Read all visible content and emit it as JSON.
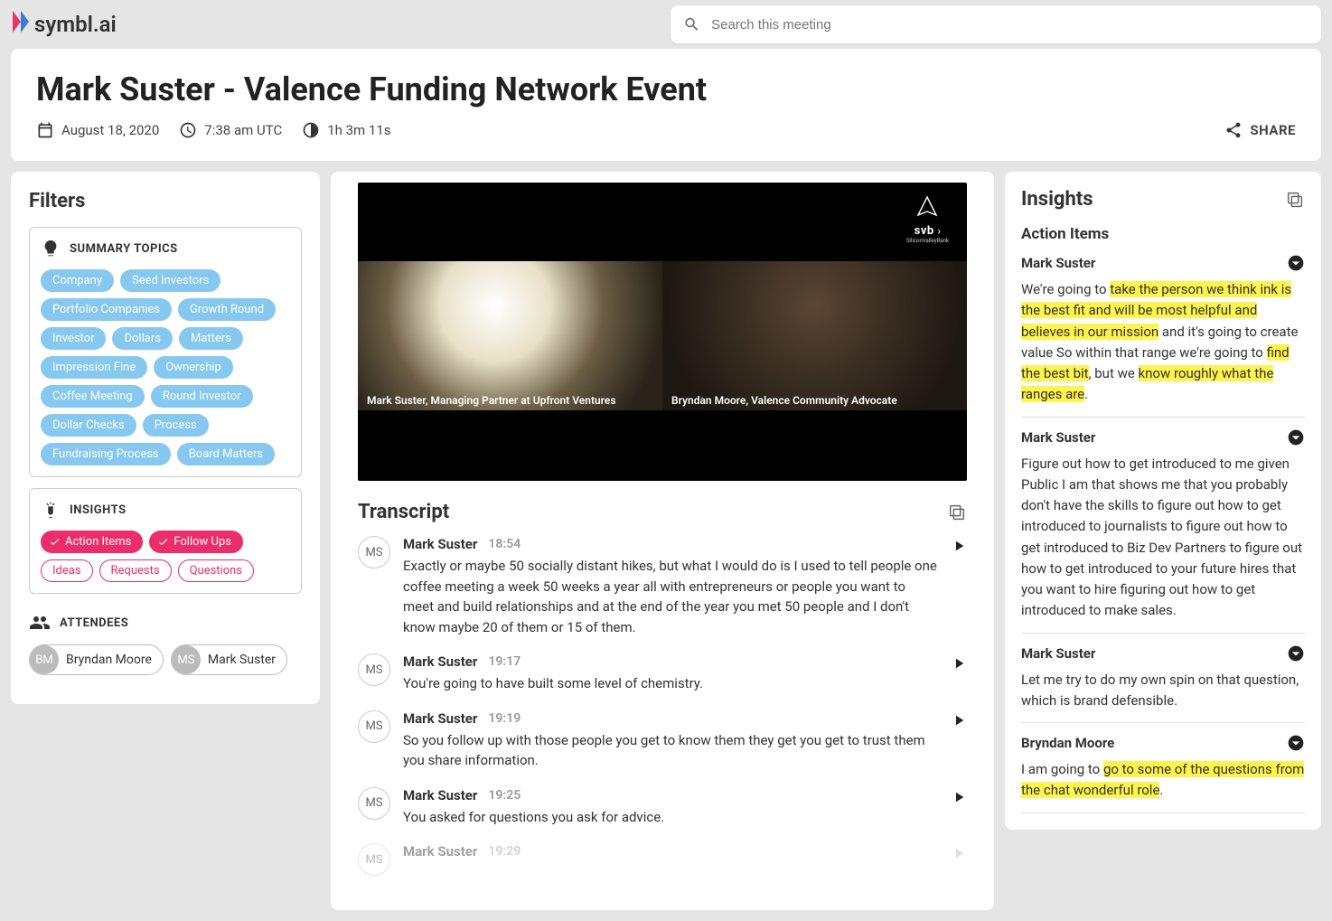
{
  "brand": "symbl.ai",
  "search": {
    "placeholder": "Search this meeting"
  },
  "title": "Mark Suster - Valence Funding Network Event",
  "meta": {
    "date": "August 18, 2020",
    "time": "7:38 am UTC",
    "duration": "1h 3m 11s"
  },
  "share_label": "SHARE",
  "filters": {
    "title": "Filters",
    "topics_label": "SUMMARY TOPICS",
    "insights_label": "INSIGHTS",
    "attendees_label": "ATTENDEES",
    "topics": [
      "Company",
      "Seed Investors",
      "Portfolio Companies",
      "Growth Round",
      "Investor",
      "Dollars",
      "Matters",
      "Impression Fine",
      "Ownership",
      "Coffee Meeting",
      "Round Investor",
      "Dollar Checks",
      "Process",
      "Fundraising Process",
      "Board Matters"
    ],
    "insights": [
      {
        "label": "Action Items",
        "active": true
      },
      {
        "label": "Follow Ups",
        "active": true
      },
      {
        "label": "Ideas",
        "active": false
      },
      {
        "label": "Requests",
        "active": false
      },
      {
        "label": "Questions",
        "active": false
      }
    ],
    "attendees": [
      {
        "initials": "BM",
        "name": "Bryndan Moore"
      },
      {
        "initials": "MS",
        "name": "Mark Suster"
      }
    ]
  },
  "video": {
    "caption_left": "Mark Suster, Managing Partner at Upfront Ventures",
    "caption_right": "Bryndan Moore, Valence Community Advocate",
    "sponsor_label": "svb",
    "sponsor_sub": "SiliconValleyBank"
  },
  "transcript": {
    "title": "Transcript",
    "entries": [
      {
        "initials": "MS",
        "speaker": "Mark Suster",
        "time": "18:54",
        "text": "Exactly or maybe 50 socially distant hikes, but what I would do is I used to tell people one coffee meeting a week 50 weeks a year all with entrepreneurs or people you want to meet and build relationships and at the end of the year you met 50 people and I don't know maybe 20 of them or 15 of them.",
        "faded": false
      },
      {
        "initials": "MS",
        "speaker": "Mark Suster",
        "time": "19:17",
        "text": "You're going to have built some level of chemistry.",
        "faded": false
      },
      {
        "initials": "MS",
        "speaker": "Mark Suster",
        "time": "19:19",
        "text": "So you follow up with those people you get to know them they get you get to trust them you share information.",
        "faded": false
      },
      {
        "initials": "MS",
        "speaker": "Mark Suster",
        "time": "19:25",
        "text": "You asked for questions you ask for advice.",
        "faded": false
      },
      {
        "initials": "MS",
        "speaker": "Mark Suster",
        "time": "19:29",
        "text": "",
        "faded": true
      }
    ]
  },
  "insights": {
    "title": "Insights",
    "section": "Action Items",
    "items": [
      {
        "speaker": "Mark Suster",
        "segments": [
          {
            "t": "We're going to ",
            "h": false
          },
          {
            "t": "take the person we think ink is the best fit and will be most helpful and believes in our mission",
            "h": true
          },
          {
            "t": " and it's going to create value So within that range we're going to ",
            "h": false
          },
          {
            "t": "find the best bit",
            "h": true
          },
          {
            "t": ", but we ",
            "h": false
          },
          {
            "t": "know roughly what the ranges are",
            "h": true
          },
          {
            "t": ".",
            "h": false
          }
        ]
      },
      {
        "speaker": "Mark Suster",
        "segments": [
          {
            "t": "Figure out how to get introduced to me given Public I am that shows me that you probably don't have the skills to figure out how to get introduced to journalists to figure out how to get introduced to Biz Dev Partners to figure out how to get introduced to your future hires that you want to hire figuring out how to get introduced to make sales.",
            "h": false
          }
        ]
      },
      {
        "speaker": "Mark Suster",
        "segments": [
          {
            "t": "Let me try to do my own spin on that question, which is brand defensible.",
            "h": false
          }
        ]
      },
      {
        "speaker": "Bryndan Moore",
        "segments": [
          {
            "t": "I am going to ",
            "h": false
          },
          {
            "t": "go to some of the questions from the chat wonderful role",
            "h": true
          },
          {
            "t": ".",
            "h": false
          }
        ]
      }
    ]
  }
}
